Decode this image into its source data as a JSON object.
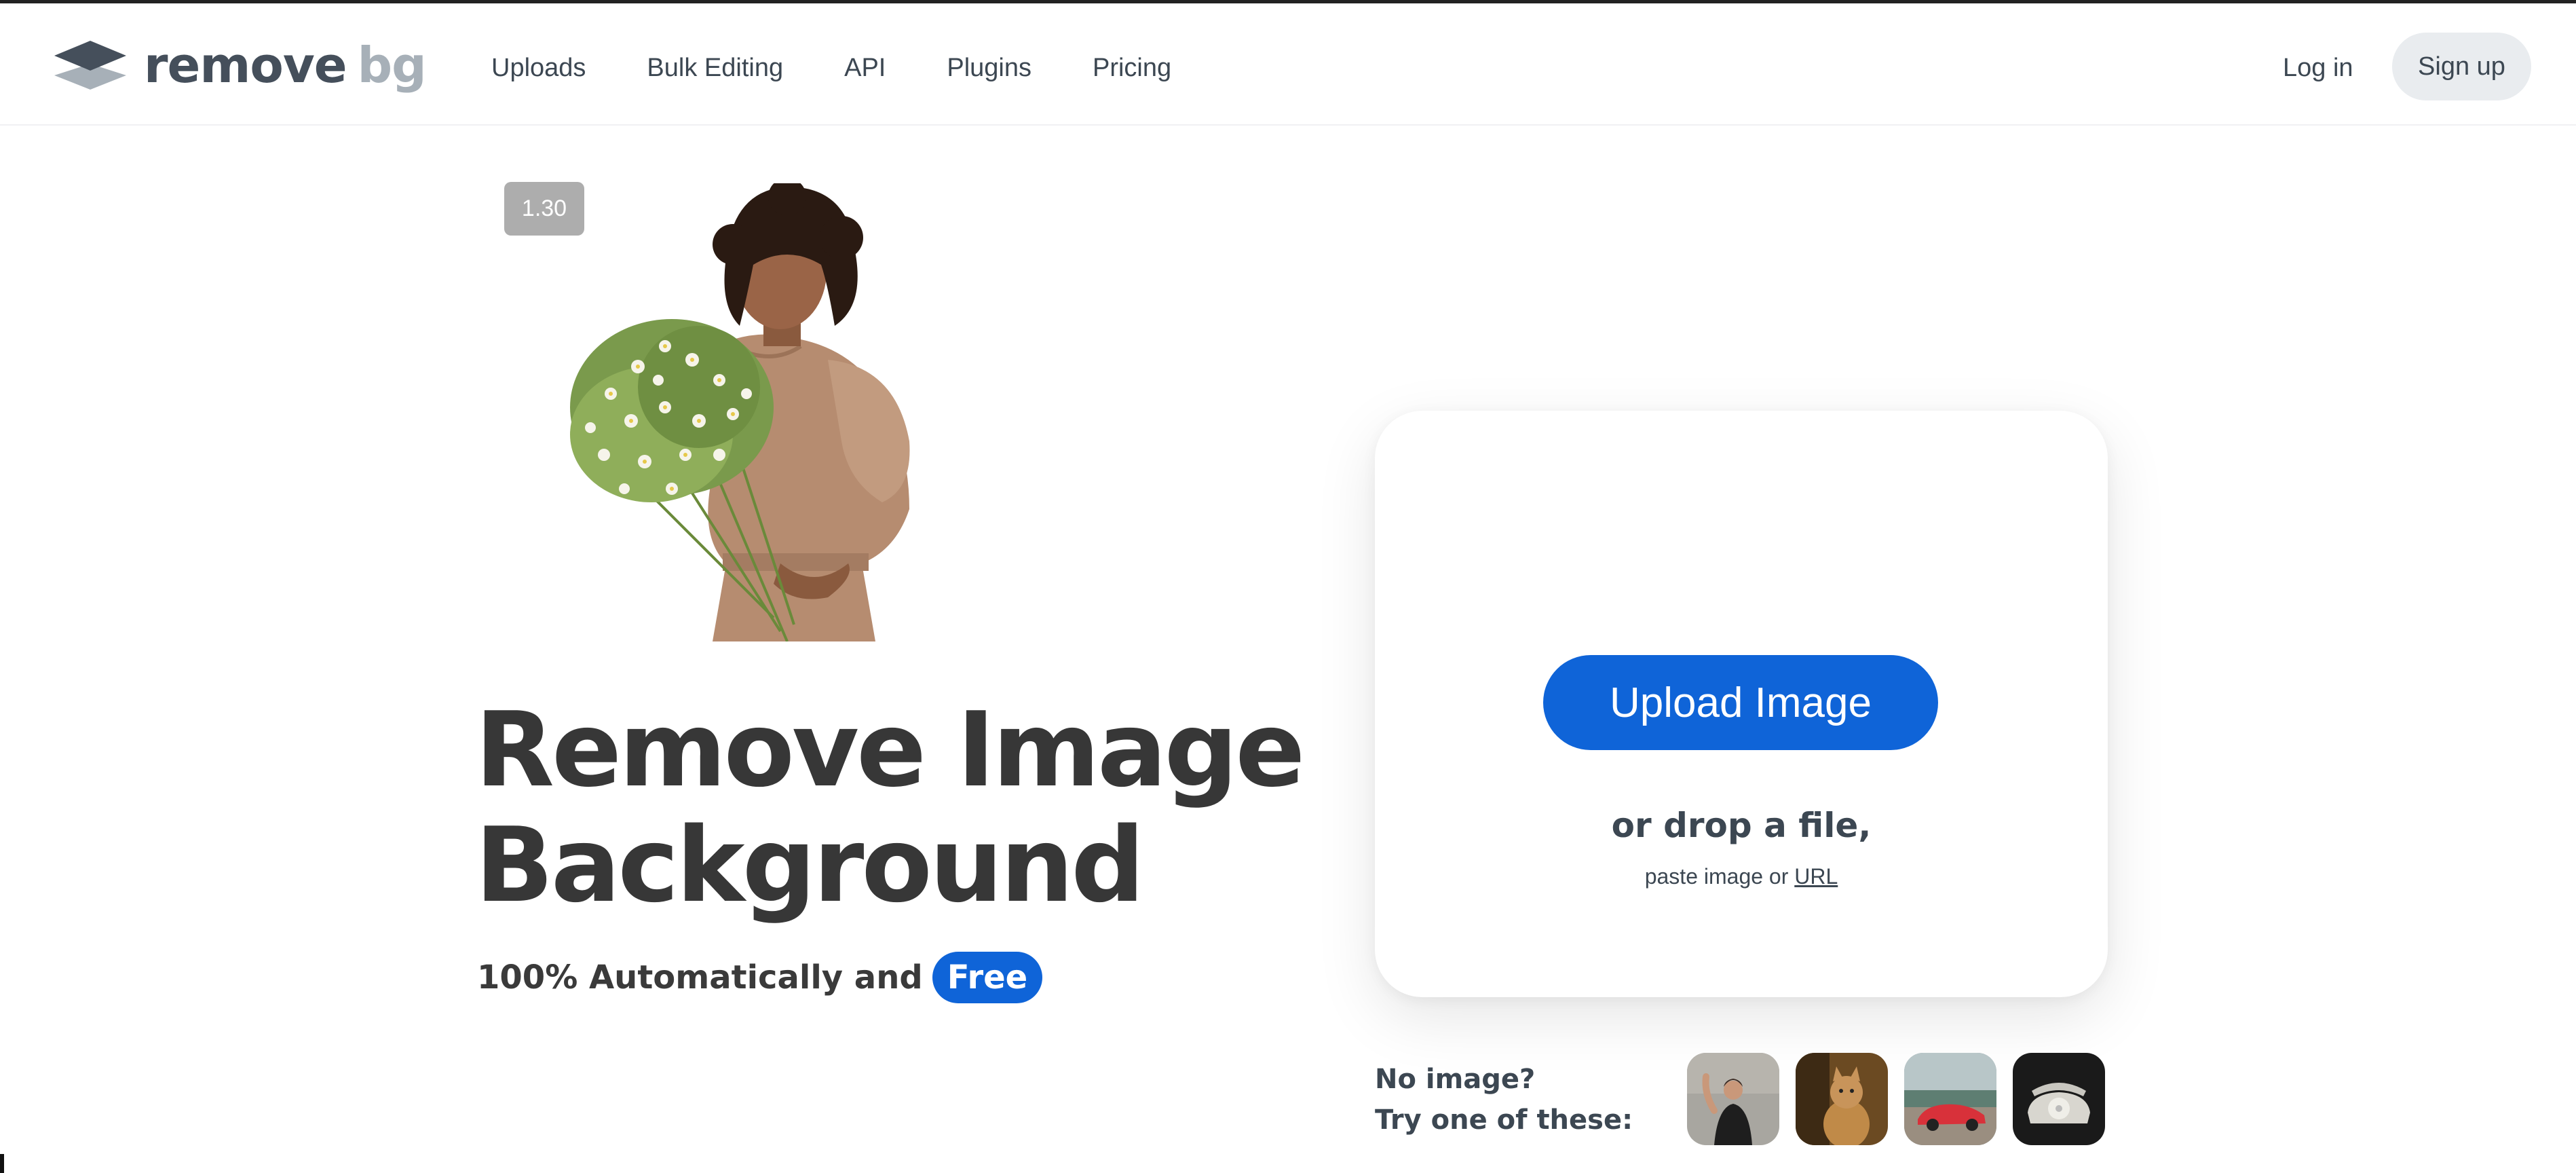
{
  "header": {
    "logo": {
      "word1": "remove",
      "word2": "bg",
      "icon": "layers-logo-icon"
    },
    "nav": [
      {
        "label": "Uploads"
      },
      {
        "label": "Bulk Editing"
      },
      {
        "label": "API"
      },
      {
        "label": "Plugins"
      },
      {
        "label": "Pricing"
      }
    ],
    "login_label": "Log in",
    "signup_label": "Sign up"
  },
  "hero": {
    "version_badge": "1.30",
    "title_line1": "Remove Image",
    "title_line2": "Background",
    "subtitle": "100% Automatically and",
    "free_label": "Free"
  },
  "upload": {
    "button_label": "Upload Image",
    "drop_text": "or drop a file,",
    "paste_text": "paste image or",
    "url_label": "URL"
  },
  "samples": {
    "line1": "No image?",
    "line2": "Try one of these:",
    "items": [
      {
        "icon": "woman-sample-thumbnail"
      },
      {
        "icon": "cat-sample-thumbnail"
      },
      {
        "icon": "car-sample-thumbnail"
      },
      {
        "icon": "telephone-sample-thumbnail"
      }
    ]
  },
  "colors": {
    "accent": "#0f64d8",
    "text": "#3c4752",
    "logo_dark": "#454f5b",
    "logo_light": "#a7b0b8"
  }
}
